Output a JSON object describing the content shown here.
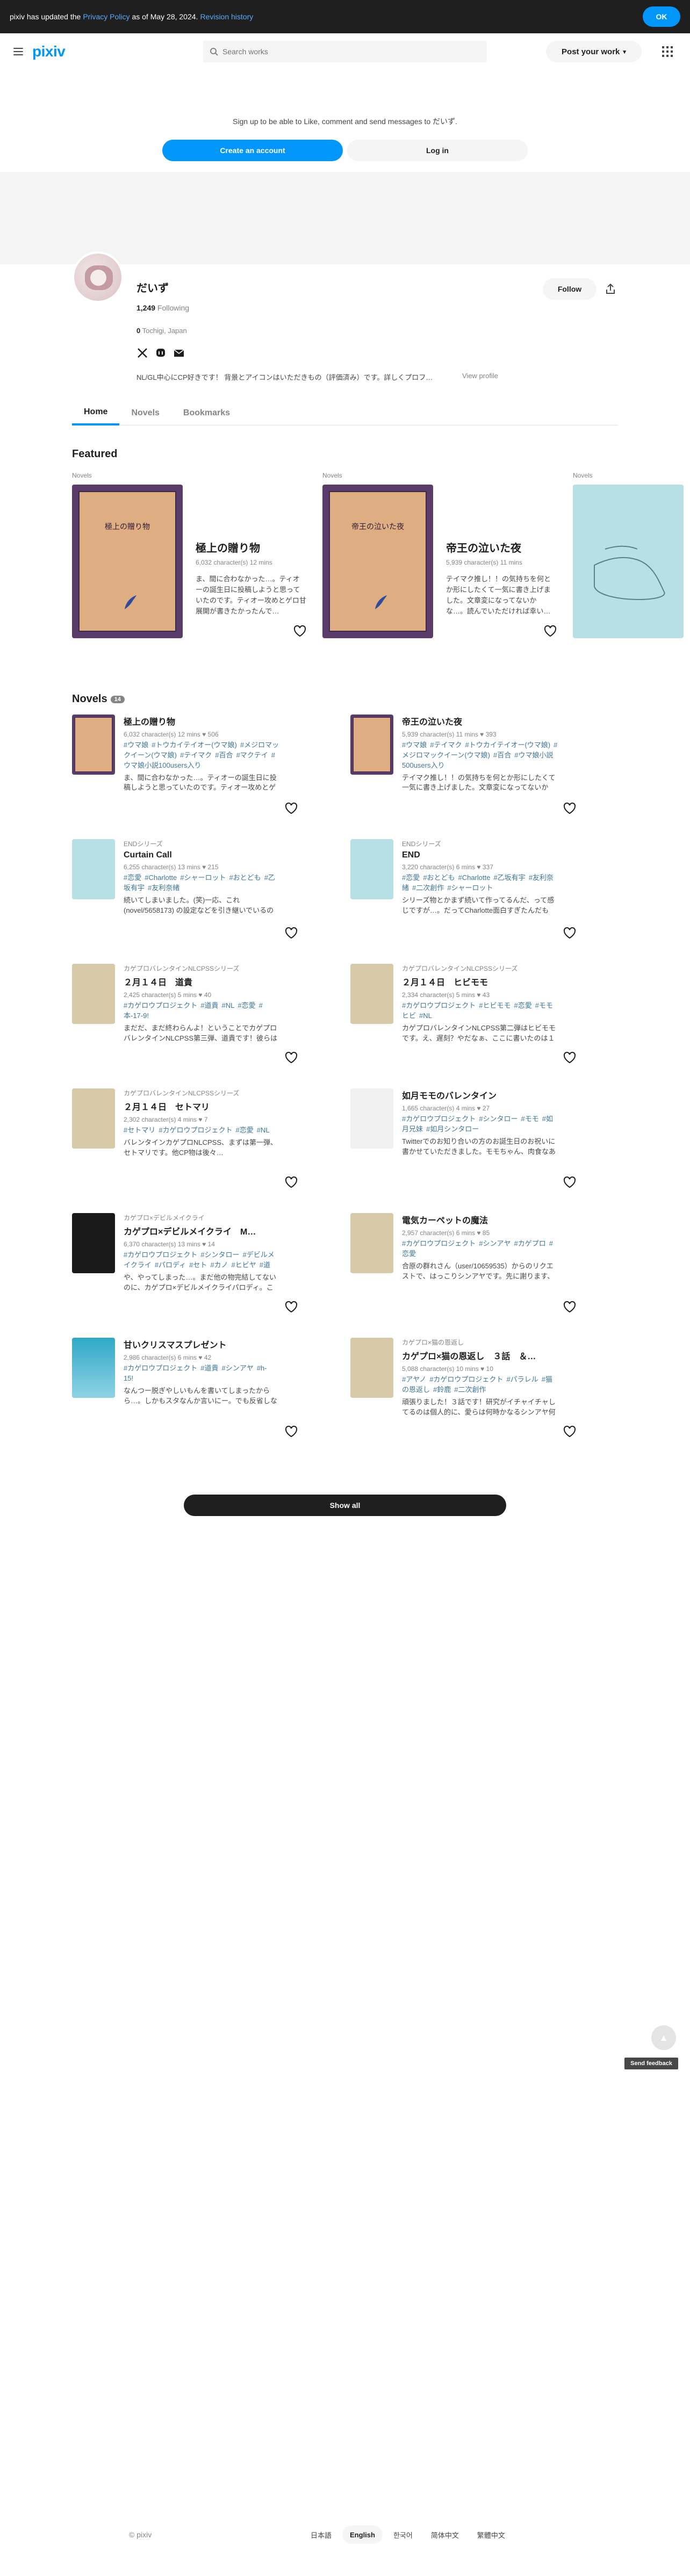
{
  "notice": {
    "prefix": "pixiv has updated the",
    "policy_link": "Privacy Policy",
    "middle": "as of May 28, 2024.",
    "history_link": "Revision history",
    "ok": "OK"
  },
  "header": {
    "logo": "pixiv",
    "search_placeholder": "Search works",
    "post_label": "Post your work"
  },
  "signup": {
    "message": "Sign up to be able to Like, comment and send messages to だいず.",
    "create_label": "Create an account",
    "login_label": "Log in"
  },
  "profile": {
    "name": "だいず",
    "following_count": "1,249",
    "following_label": "Following",
    "follow_label": "Follow",
    "location_count": "0",
    "location": "Tochigi, Japan",
    "bio": "NL/GL中心にCP好きです！ 背景とアイコンはいただきもの（評価済み）です。詳しくプロフ…",
    "view_profile": "View profile"
  },
  "tabs": [
    "Home",
    "Novels",
    "Bookmarks"
  ],
  "featured": {
    "title": "Featured",
    "items": [
      {
        "label": "Novels",
        "cover_title": "極上の贈り物",
        "title": "極上の贈り物",
        "meta": "6,032 character(s)  12 mins",
        "desc": "ま、間に合わなかった…。ティオーの誕生日に投稿しようと思っていたのです。ティオー攻めとゲロ甘展開が書きたかったんで…"
      },
      {
        "label": "Novels",
        "cover_title": "帝王の泣いた夜",
        "title": "帝王の泣いた夜",
        "meta": "5,939 character(s)  11 mins",
        "desc": "テイマク推し！！の気持ちを何とか形にしたくて一気に書き上げました。文章変になってないかな…。読んでいただければ幸い…"
      },
      {
        "label": "Novels"
      }
    ]
  },
  "novels": {
    "title": "Novels",
    "count": "14",
    "items": [
      {
        "series": "",
        "title": "極上の贈り物",
        "meta": "6,032 character(s)  12 mins  ♥ 506",
        "tags": [
          "#ウマ娘",
          "#トウカイテイオー(ウマ娘)",
          "#メジロマックイーン(ウマ娘)",
          "#テイマク",
          "#百合",
          "#マクテイ",
          "#ウマ娘小説100users入り"
        ],
        "desc": "ま、間に合わなかった…。ティオーの誕生日に投稿しようと思っていたのです。ティオー攻めとゲロ甘展開が書…"
      },
      {
        "series": "",
        "title": "帝王の泣いた夜",
        "meta": "5,939 character(s)  11 mins  ♥ 393",
        "tags": [
          "#ウマ娘",
          "#テイマク",
          "#トウカイテイオー(ウマ娘)",
          "#メジロマックイーン(ウマ娘)",
          "#百合",
          "#ウマ娘小説500users入り"
        ],
        "desc": "テイマク推し！！の気持ちを何とか形にしたくて一気に書き上げました。文章変になってないかな…。読んでいただけ…"
      },
      {
        "series": "ENDシリーズ",
        "title": "Curtain Call",
        "meta": "6,255 character(s)  13 mins  ♥ 215",
        "tags": [
          "#恋愛",
          "#Charlotte",
          "#シャーロット",
          "#おとども",
          "#乙坂有宇",
          "#友利奈緒"
        ],
        "desc": "続いてしまいました。(笑)一応、これ(novel/5658173) の設定などを引き継いでいるので、先に読んでいただけ…"
      },
      {
        "series": "ENDシリーズ",
        "title": "END",
        "meta": "3,220 character(s)  6 mins  ♥ 337",
        "tags": [
          "#恋愛",
          "#おとども",
          "#Charlotte",
          "#乙坂有宇",
          "#友利奈緒",
          "#二次創作",
          "#シャーロット"
        ],
        "desc": "シリーズ物とかまず続いて作ってるんだ、って感じですが…。だってCharlotte面白すぎたんだもん！おとども可愛すぎな…"
      },
      {
        "series": "カゲプロバレンタインNLCPSSシリーズ",
        "title": "２月１４日　道貴",
        "meta": "2,425 character(s)  5 mins  ♥ 40",
        "tags": [
          "#カゲロウプロジェクト",
          "#道貴",
          "#NL",
          "#恋愛",
          "#本-17-9!"
        ],
        "desc": "まだだ、まだ終わらんよ！ということでカゲプロバレンタインNLCPSS第三弾、道貴です！彼らはとにかく甘くしたか…"
      },
      {
        "series": "カゲプロバレンタインNLCPSSシリーズ",
        "title": "２月１４日　ヒビモモ",
        "meta": "2,334 character(s)  5 mins  ♥ 43",
        "tags": [
          "#カゲロウプロジェクト",
          "#ヒビモモ",
          "#恋愛",
          "#モモヒビ",
          "#NL"
        ],
        "desc": "カゲプロバレンタインNLCPSS第二弾はヒビモモです。え、遅刻？やだなぁ、ここに書いたのは１４日ですって！セーフ…"
      },
      {
        "series": "カゲプロバレンタインNLCPSSシリーズ",
        "title": "２月１４日　セトマリ",
        "meta": "2,302 character(s)  4 mins  ♥ 7",
        "tags": [
          "#セトマリ",
          "#カゲロウプロジェクト",
          "#恋愛",
          "#NL"
        ],
        "desc": "バレンタインカゲプロNLCPSS、まずは第一弾、セトマリです。他CP物は後々…"
      },
      {
        "series": "",
        "title": "如月モモのバレンタイン",
        "meta": "1,665 character(s)  4 mins  ♥ 27",
        "tags": [
          "#カゲロウプロジェクト",
          "#シンタロー",
          "#モモ",
          "#如月兄妹",
          "#如月シンタロー"
        ],
        "desc": "Twitterでのお知り合いの方のお誕生日のお祝いに書かせていただきました。モモちゃん、肉食なあたり生意気してい…"
      },
      {
        "series": "カゲプロ×デビルメイクライ",
        "title": "カゲプロ×デビルメイクライ　M…",
        "meta": "6,370 character(s)  13 mins  ♥ 14",
        "tags": [
          "#カゲロウプロジェクト",
          "#シンタロー",
          "#デビルメイクライ",
          "#パロディ",
          "#セト",
          "#カノ",
          "#ヒビヤ",
          "#道"
        ],
        "desc": "や、やってしまった…。まだ他の物完結してないのに、カゲプロ×デビルメイクライパロディ。このシリーズにも、…"
      },
      {
        "series": "",
        "title": "電気カーペットの魔法",
        "meta": "2,957 character(s)  6 mins  ♥ 85",
        "tags": [
          "#カゲロウプロジェクト",
          "#シンアヤ",
          "#カゲプロ",
          "#恋愛"
        ],
        "desc": "合原の群れさん（user/10659535）からのリクエストで、はっこりシンアヤです。先に謝ります、甲し訳ありません…"
      },
      {
        "series": "",
        "title": "甘いクリスマスプレゼント",
        "meta": "2,986 character(s)  6 mins  ♥ 42",
        "tags": [
          "#カゲロウプロジェクト",
          "#道貴",
          "#シンアヤ",
          "#h-15!"
        ],
        "desc": "なんつー脱ぎやしいもんを書いてしまったからら…。しかもスタなんか言いにー。でも反省しない！というわけ…"
      },
      {
        "series": "カゲプロ×猫の恩返し",
        "title": "カゲプロ×猫の恩返し　３話　＆…",
        "meta": "5,088 character(s)  10 mins  ♥ 10",
        "tags": [
          "#アヤノ",
          "#カゲロウプロジェクト",
          "#パラレル",
          "#猫の恩返し",
          "#鈴鹿",
          "#二次創作"
        ],
        "desc": "頑張りました！３話です！研究がイチャイチャしてるのは個人的に、愛らは何時かなるシンアヤ何がになるのでは、というと…"
      }
    ],
    "show_all": "Show all"
  },
  "feedback": "Send feedback",
  "footer": {
    "copyright": "© pixiv",
    "languages": [
      "日本語",
      "English",
      "한국어",
      "简体中文",
      "繁體中文"
    ],
    "active_language": "English"
  },
  "colors": {
    "accent": "#0096fa",
    "tag": "#3d7699",
    "dark": "#1f1f1f"
  }
}
